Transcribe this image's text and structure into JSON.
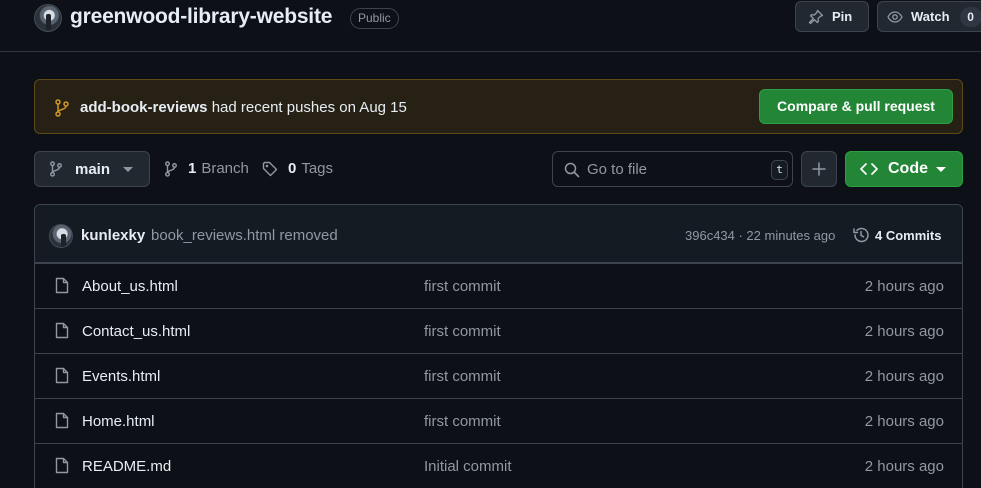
{
  "repo": {
    "name": "greenwood-library-website",
    "visibility": "Public"
  },
  "header_actions": {
    "pin_label": "Pin",
    "watch_label": "Watch",
    "watch_count": "0"
  },
  "push_banner": {
    "branch": "add-book-reviews",
    "message": " had recent pushes on Aug 15",
    "button_label": "Compare & pull request"
  },
  "toolbar": {
    "current_branch": "main",
    "branch_count": "1",
    "branch_label": "Branch",
    "tag_count": "0",
    "tag_label": "Tags",
    "goto_file_placeholder": "Go to file",
    "goto_file_shortcut": "t",
    "code_button_label": "Code"
  },
  "latest_commit": {
    "author": "kunlexky",
    "message": "book_reviews.html removed",
    "meta": "396c434 · 22 minutes ago",
    "commits_label": "4 Commits"
  },
  "files": [
    {
      "name": "About_us.html",
      "commit": "first commit",
      "age": "2 hours ago"
    },
    {
      "name": "Contact_us.html",
      "commit": "first commit",
      "age": "2 hours ago"
    },
    {
      "name": "Events.html",
      "commit": "first commit",
      "age": "2 hours ago"
    },
    {
      "name": "Home.html",
      "commit": "first commit",
      "age": "2 hours ago"
    },
    {
      "name": "README.md",
      "commit": "Initial commit",
      "age": "2 hours ago"
    }
  ],
  "colors": {
    "background": "#0d1117",
    "accent_green": "#238636",
    "banner_background": "#272115",
    "branch_icon_yellow": "#d29922"
  },
  "icons": [
    "pin-icon",
    "eye-icon",
    "git-branch-icon",
    "tag-icon",
    "search-icon",
    "plus-icon",
    "code-icon",
    "history-icon",
    "file-icon",
    "caret-down-icon"
  ]
}
